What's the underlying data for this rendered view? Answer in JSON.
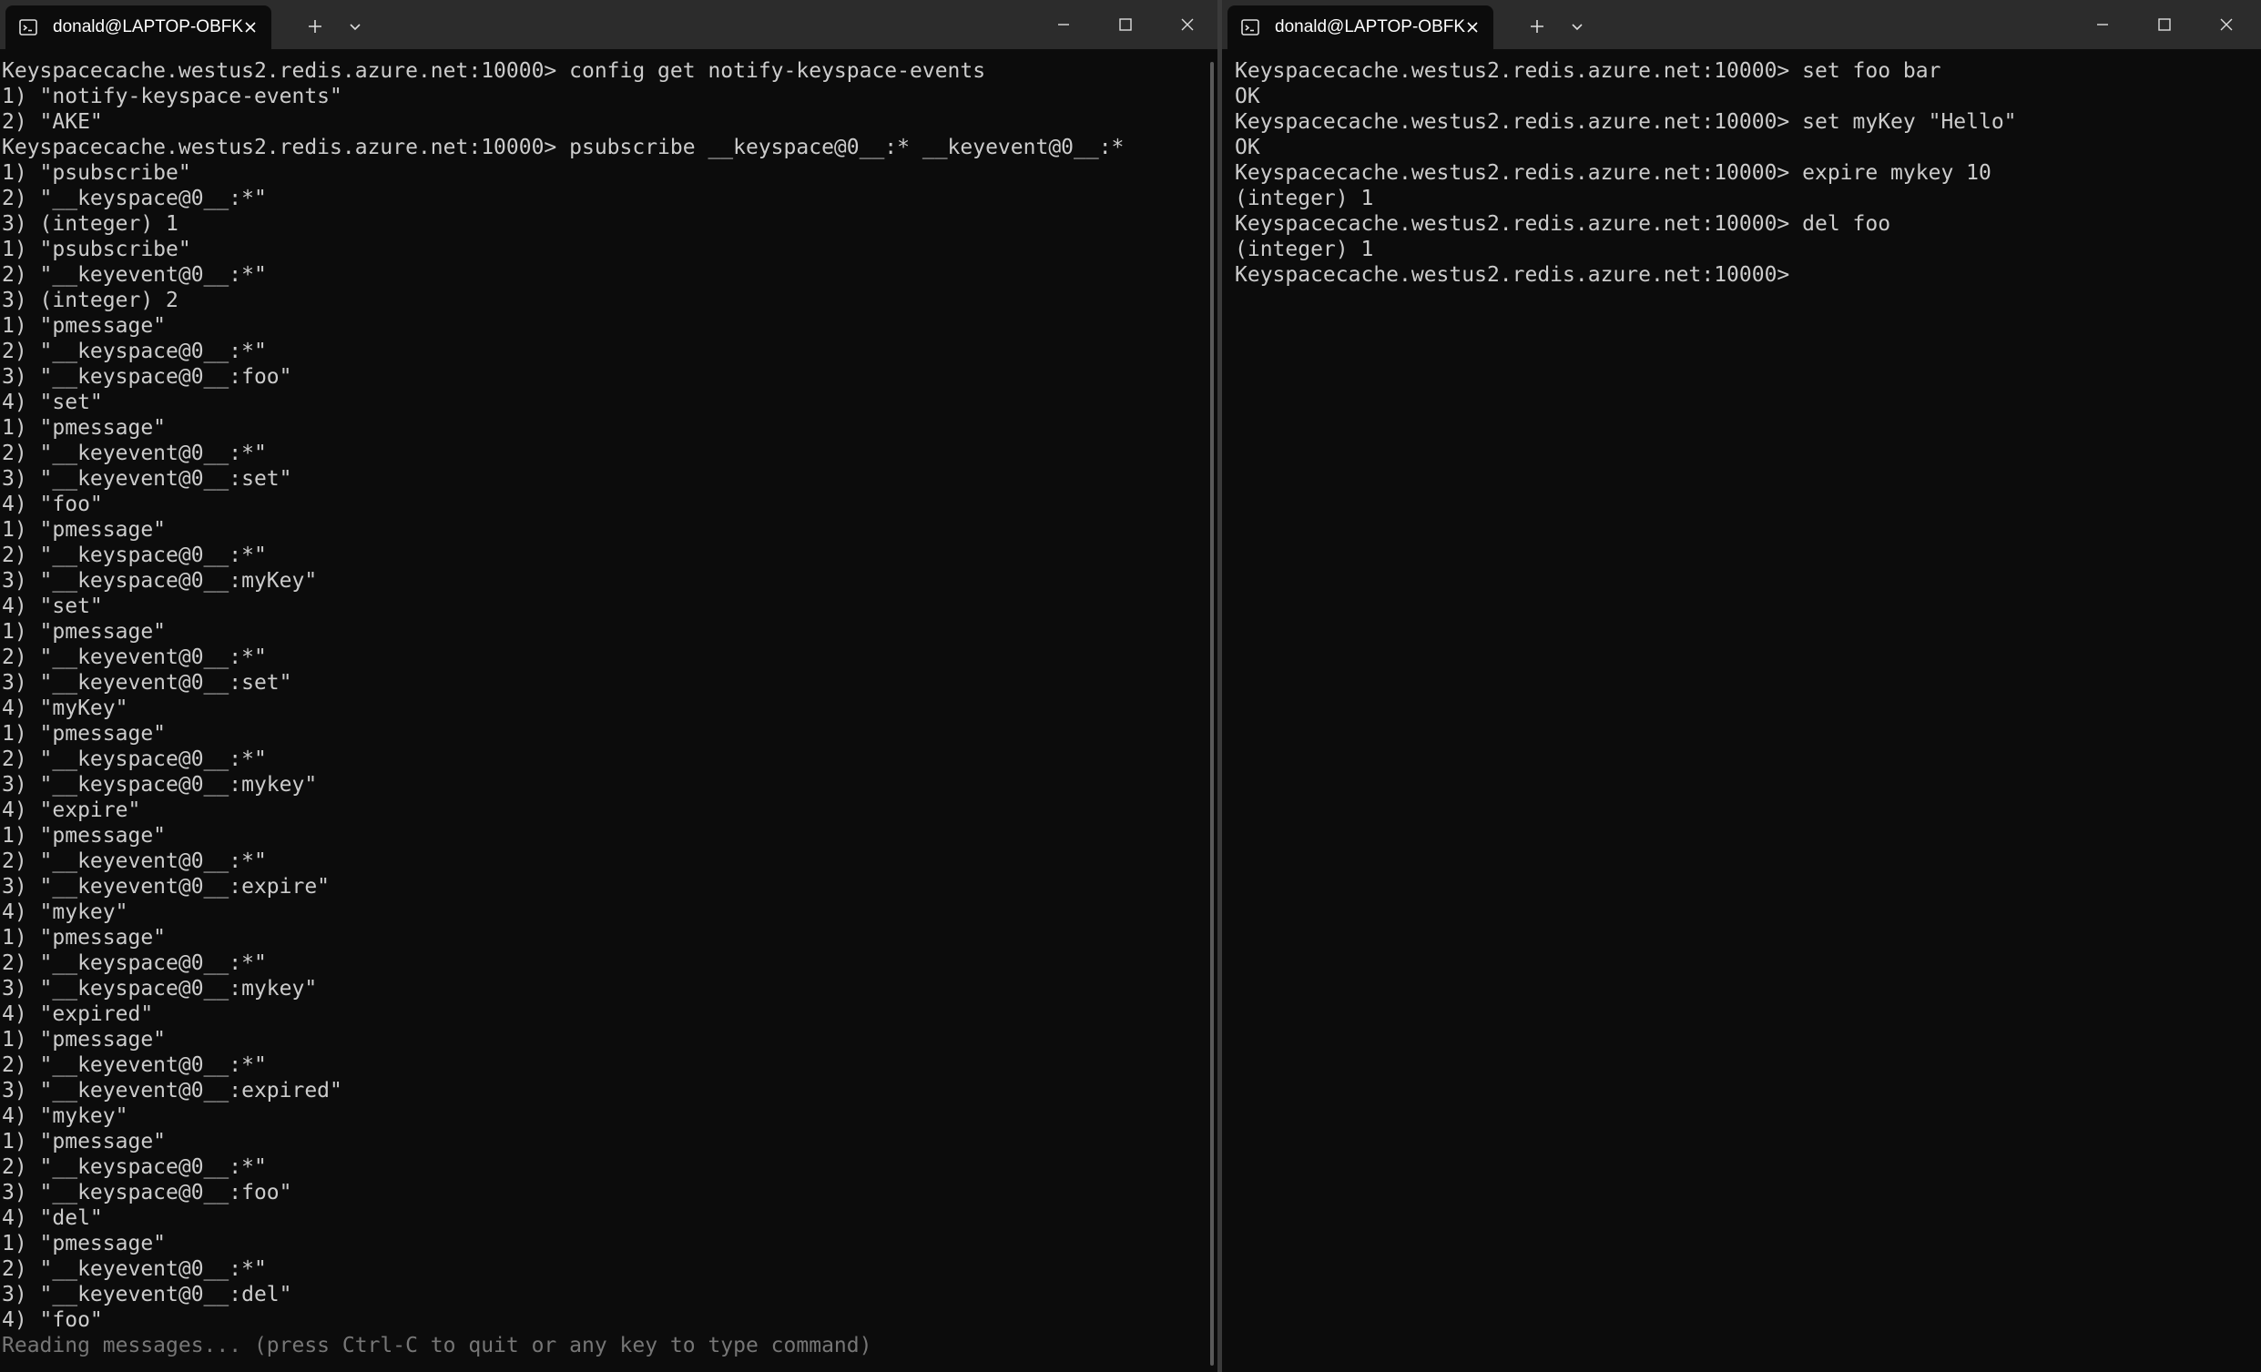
{
  "colors": {
    "background": "#0c0c0c",
    "titlebar": "#2c2c2c",
    "text": "#cccccc",
    "dim_text": "#767676"
  },
  "left_window": {
    "tab_title": "donald@LAPTOP-OBFK",
    "icons": {
      "tab": "terminal-icon",
      "close_tab": "close-icon",
      "new_tab": "plus-icon",
      "dropdown": "chevron-down-icon",
      "minimize": "minimize-icon",
      "maximize": "maximize-icon",
      "close_window": "close-icon"
    },
    "lines": [
      "Keyspacecache.westus2.redis.azure.net:10000> config get notify-keyspace-events",
      "1) \"notify-keyspace-events\"",
      "2) \"AKE\"",
      "Keyspacecache.westus2.redis.azure.net:10000> psubscribe __keyspace@0__:* __keyevent@0__:*",
      "1) \"psubscribe\"",
      "2) \"__keyspace@0__:*\"",
      "3) (integer) 1",
      "1) \"psubscribe\"",
      "2) \"__keyevent@0__:*\"",
      "3) (integer) 2",
      "1) \"pmessage\"",
      "2) \"__keyspace@0__:*\"",
      "3) \"__keyspace@0__:foo\"",
      "4) \"set\"",
      "1) \"pmessage\"",
      "2) \"__keyevent@0__:*\"",
      "3) \"__keyevent@0__:set\"",
      "4) \"foo\"",
      "1) \"pmessage\"",
      "2) \"__keyspace@0__:*\"",
      "3) \"__keyspace@0__:myKey\"",
      "4) \"set\"",
      "1) \"pmessage\"",
      "2) \"__keyevent@0__:*\"",
      "3) \"__keyevent@0__:set\"",
      "4) \"myKey\"",
      "1) \"pmessage\"",
      "2) \"__keyspace@0__:*\"",
      "3) \"__keyspace@0__:mykey\"",
      "4) \"expire\"",
      "1) \"pmessage\"",
      "2) \"__keyevent@0__:*\"",
      "3) \"__keyevent@0__:expire\"",
      "4) \"mykey\"",
      "1) \"pmessage\"",
      "2) \"__keyspace@0__:*\"",
      "3) \"__keyspace@0__:mykey\"",
      "4) \"expired\"",
      "1) \"pmessage\"",
      "2) \"__keyevent@0__:*\"",
      "3) \"__keyevent@0__:expired\"",
      "4) \"mykey\"",
      "1) \"pmessage\"",
      "2) \"__keyspace@0__:*\"",
      "3) \"__keyspace@0__:foo\"",
      "4) \"del\"",
      "1) \"pmessage\"",
      "2) \"__keyevent@0__:*\"",
      "3) \"__keyevent@0__:del\"",
      "4) \"foo\""
    ],
    "status_line": "Reading messages... (press Ctrl-C to quit or any key to type command)"
  },
  "right_window": {
    "tab_title": "donald@LAPTOP-OBFK",
    "icons": {
      "tab": "terminal-icon",
      "close_tab": "close-icon",
      "new_tab": "plus-icon",
      "dropdown": "chevron-down-icon",
      "minimize": "minimize-icon",
      "maximize": "maximize-icon",
      "close_window": "close-icon"
    },
    "lines": [
      "Keyspacecache.westus2.redis.azure.net:10000> set foo bar",
      "OK",
      "Keyspacecache.westus2.redis.azure.net:10000> set myKey \"Hello\"",
      "OK",
      "Keyspacecache.westus2.redis.azure.net:10000> expire mykey 10",
      "(integer) 1",
      "Keyspacecache.westus2.redis.azure.net:10000> del foo",
      "(integer) 1",
      "Keyspacecache.westus2.redis.azure.net:10000>"
    ]
  }
}
